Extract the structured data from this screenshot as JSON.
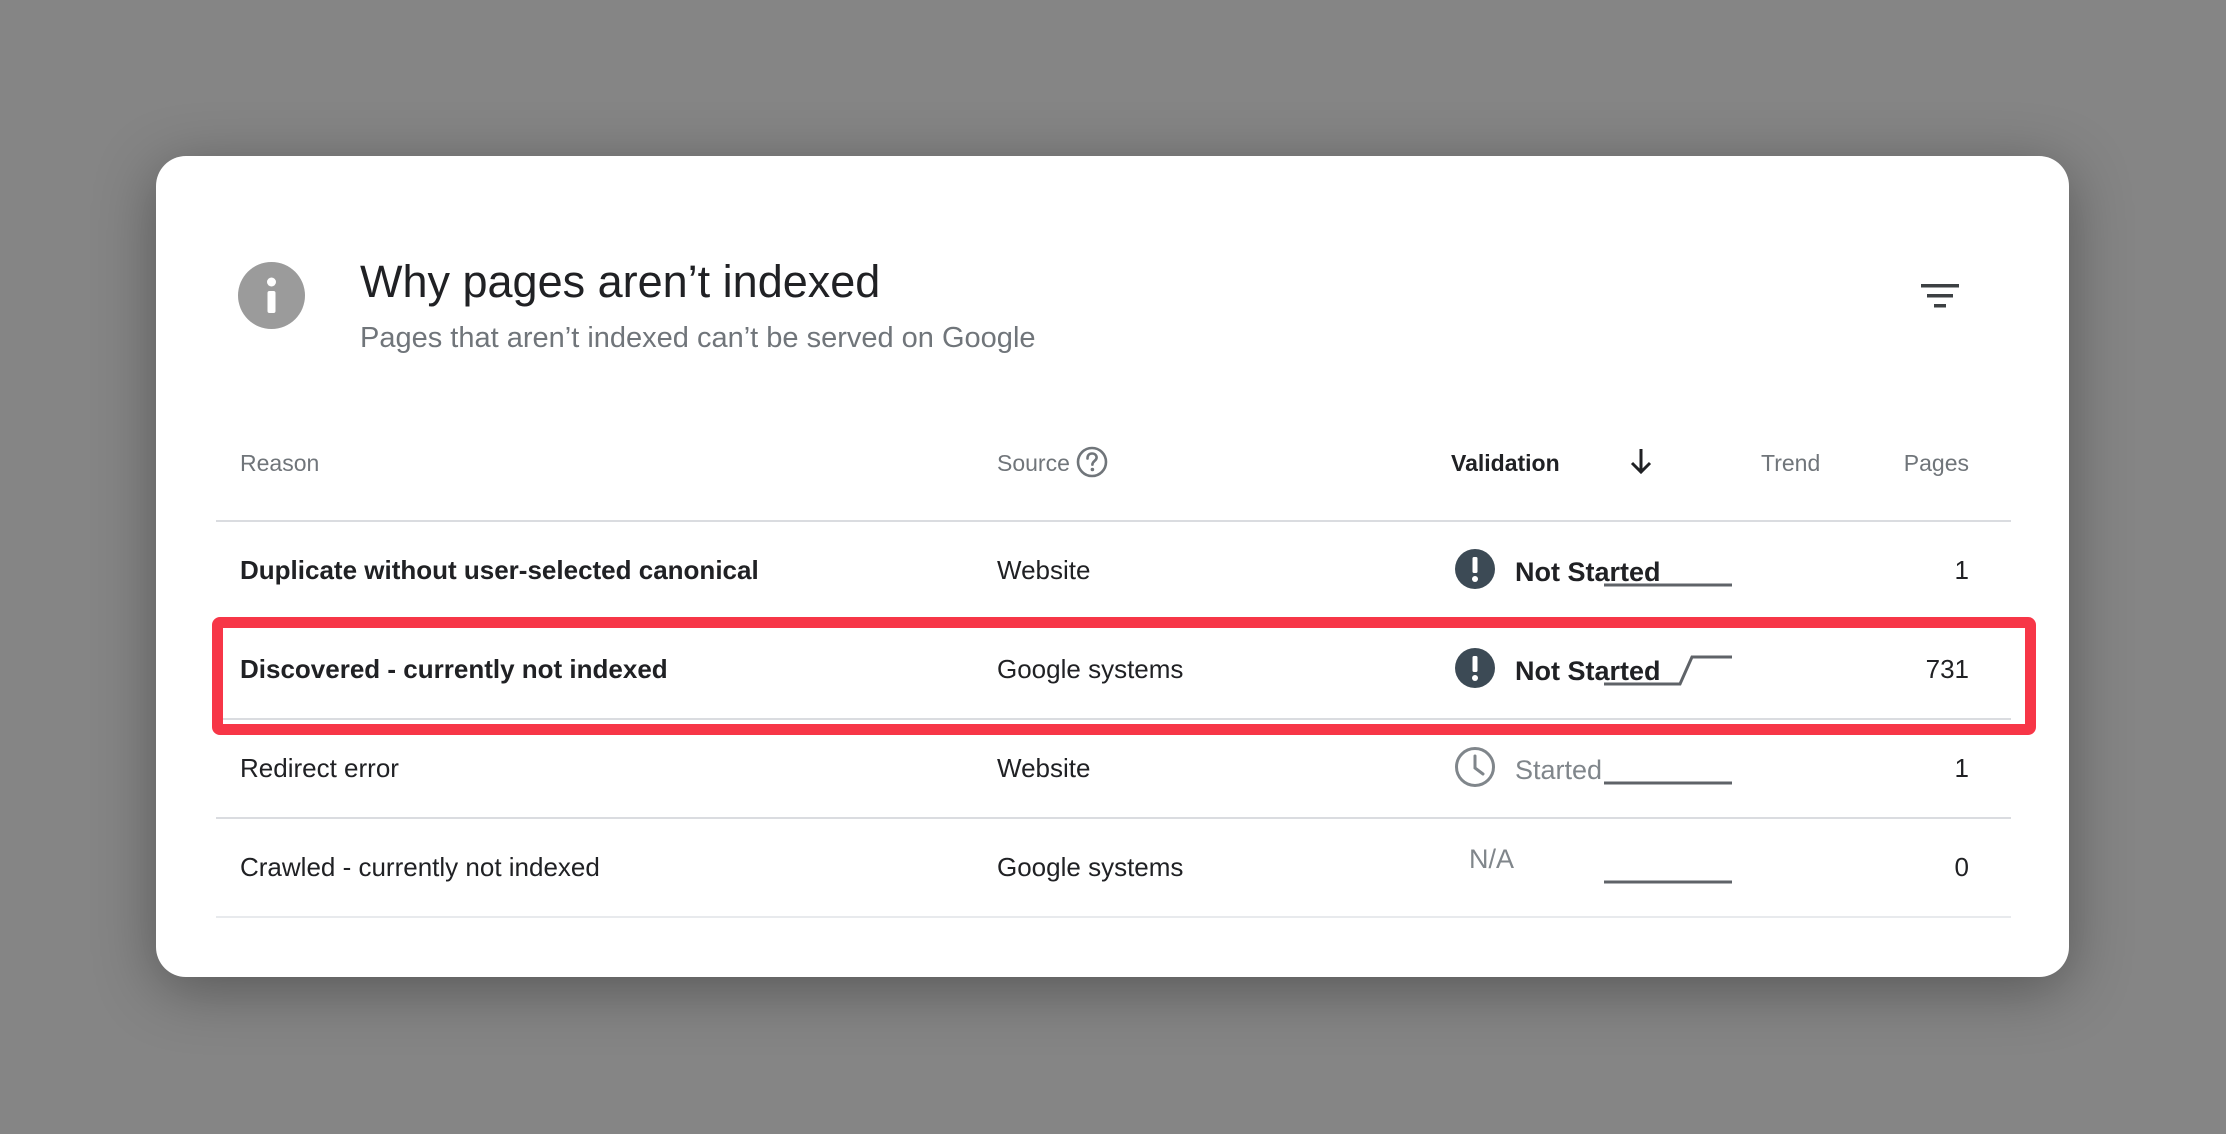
{
  "card": {
    "title": "Why pages aren’t indexed",
    "subtitle": "Pages that aren’t indexed can’t be served on Google",
    "info_icon": "info-icon",
    "filter_icon": "filter-icon"
  },
  "table": {
    "headers": {
      "reason": "Reason",
      "source": "Source",
      "validation": "Validation",
      "trend": "Trend",
      "pages": "Pages"
    },
    "rows": [
      {
        "reason": "Duplicate without user-selected canonical",
        "source": "Website",
        "validation": "Not Started",
        "validation_icon": "exclamation-icon",
        "trend": "flat",
        "pages": "1"
      },
      {
        "reason": "Discovered - currently not indexed",
        "source": "Google systems",
        "validation": "Not Started",
        "validation_icon": "exclamation-icon",
        "trend": "step-up",
        "pages": "731"
      },
      {
        "reason": "Redirect error",
        "source": "Website",
        "validation": "Started",
        "validation_icon": "clock-icon",
        "trend": "flat",
        "pages": "1"
      },
      {
        "reason": "Crawled - currently not indexed",
        "source": "Google systems",
        "validation": "N/A",
        "validation_icon": "",
        "trend": "flat",
        "pages": "0"
      }
    ]
  },
  "colors": {
    "background": "#858585",
    "highlight": "#f73647",
    "status_icon": "#3c4a55"
  }
}
